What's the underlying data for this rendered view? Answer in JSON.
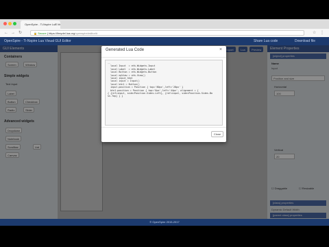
{
  "browser": {
    "tab_title": "OpenSpire - Ti-Nspire Lua Visual GUI Editor",
    "url_secure_label": "Secure",
    "url_host": "https://lheydel.lua.org",
    "url_path": "/openspire/editor/#"
  },
  "app": {
    "title": "OpenSpire - Ti-Nspire Lua Visual GUI Editor",
    "right_links": [
      "Share Lua code",
      "Download file"
    ],
    "left_panel": {
      "header": "GUI Elements",
      "containers_title": "Containers",
      "containers": [
        "Screen",
        "Window"
      ],
      "simple_title": "Simple widgets",
      "simple_label": "Text Input",
      "simple_items": [
        "Label",
        "Button",
        "Checkbox",
        "Radio",
        "Slider"
      ],
      "advanced_title": "Advanced widgets",
      "advanced_items": [
        "Dropdown",
        "Notebook",
        "Scrollbar",
        "List",
        "Canvas"
      ]
    },
    "toolbar": [
      "Export",
      "Lua",
      "Preview"
    ],
    "right_panel": {
      "header": "Element Properties",
      "section1": "[object] properties",
      "name_label": "Name",
      "name_value": "Input",
      "pos_title": "Position and size",
      "horizontal_label": "Horizontal",
      "horizontal_value": "100",
      "vertical_label": "Vertical",
      "vertical_value": "20",
      "draggable_label": "Draggable",
      "resizable_label": "Resizable",
      "section2": "[class] properties",
      "dynamic_label": "Dynamic Default Width",
      "section3": "[parent class] properties"
    },
    "footer": "© OpenSpire 2015-2017"
  },
  "modal": {
    "title": "Generated Lua Code",
    "close_icon": "close-icon",
    "code_lines": [
      "--",
      "  local Input  = etk.Widgets.Input",
      "  local Label  = etk.Widgets.Label",
      "  local Button = etk.Widgets.Button",
      "",
      "  local myView = etk.View()",
      "",
      "",
      "  local input_html",
      "  local input = Input()",
      "  local btn1 = Button()",
      "  input.position = Position { top='80px',left='28px' }",
      "  btn1.position = Position { top='0px',left='44px', alignment = {",
      "{ {ref=input, side=Position.Sides.Left}, {ref=input, side=Position.Sides.Bo",
      "ss.Top} } }"
    ],
    "close_button": "Close"
  }
}
